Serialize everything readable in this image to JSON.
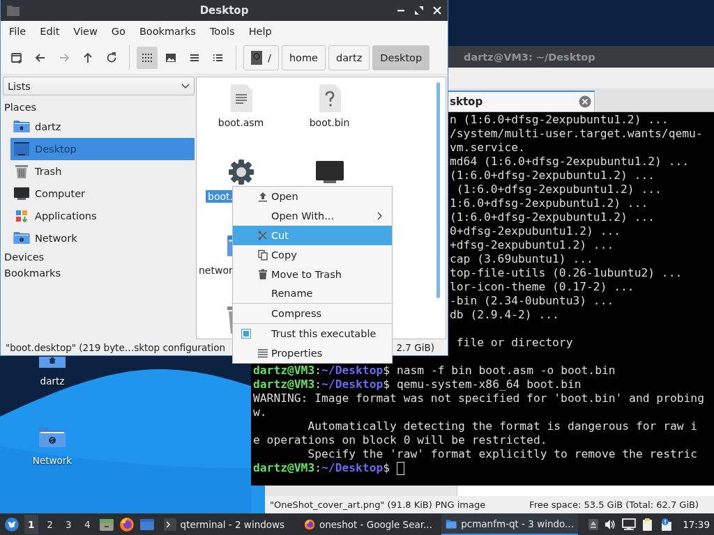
{
  "desktop_icons": [
    {
      "label": "dartz",
      "kind": "home"
    },
    {
      "label": "Network",
      "kind": "network"
    }
  ],
  "background_window": {
    "status_left": "\"OneShot_cover_art.png\" (91.8 KiB) PNG image",
    "status_right": "Free space: 53.5 GiB (Total: 62.7 GiB)"
  },
  "terminal": {
    "title": "dartz@VM3: ~/Desktop",
    "tab": "sktop",
    "lines": [
      {
        "kind": "partial",
        "text": "n (1:6.0+dfsg-2expubuntu1.2) ..."
      },
      {
        "kind": "partial",
        "text": "/system/multi-user.target.wants/qemu-"
      },
      {
        "kind": "partial",
        "text": "vm.service."
      },
      {
        "kind": "partial",
        "text": "md64 (1:6.0+dfsg-2expubuntu1.2) ..."
      },
      {
        "kind": "partial",
        "text": "(1:6.0+dfsg-2expubuntu1.2) ..."
      },
      {
        "kind": "partial",
        "text": " (1:6.0+dfsg-2expubuntu1.2) ..."
      },
      {
        "kind": "partial",
        "text": "1:6.0+dfsg-2expubuntu1.2) ..."
      },
      {
        "kind": "partial",
        "text": "(1:6.0+dfsg-2expubuntu1.2) ..."
      },
      {
        "kind": "partial",
        "text": "0+dfsg-2expubuntu1.2) ..."
      },
      {
        "kind": "partial",
        "text": "+dfsg-2expubuntu1.2) ..."
      },
      {
        "kind": "partial",
        "text": "cap (3.69ubuntu1) ..."
      },
      {
        "kind": "partial",
        "text": "top-file-utils (0.26-1ubuntu2) ..."
      },
      {
        "kind": "partial",
        "text": "lor-icon-theme (0.17-2) ..."
      },
      {
        "kind": "partial",
        "text": "-bin (2.34-0ubuntu3) ..."
      },
      {
        "kind": "partial",
        "text": "db (2.9.4-2) ..."
      },
      {
        "kind": "blank"
      },
      {
        "kind": "partial",
        "text": " file or directory"
      },
      {
        "kind": "blank"
      },
      {
        "kind": "prompt",
        "user": "dartz@VM3",
        "separator": ":",
        "path": "~/Desktop",
        "sign": "$",
        "command": "nasm -f bin boot.asm -o boot.bin"
      },
      {
        "kind": "prompt",
        "user": "dartz@VM3",
        "separator": ":",
        "path": "~/Desktop",
        "sign": "$",
        "command": "qemu-system-x86_64 boot.bin"
      },
      {
        "kind": "full",
        "text": "WARNING: Image format was not specified for 'boot.bin' and probing"
      },
      {
        "kind": "full",
        "text": "w."
      },
      {
        "kind": "full",
        "text": "        Automatically detecting the format is dangerous for raw i"
      },
      {
        "kind": "full",
        "text": "e operations on block 0 will be restricted."
      },
      {
        "kind": "full",
        "text": "        Specify the 'raw' format explicitly to remove the restric"
      },
      {
        "kind": "prompt",
        "user": "dartz@VM3",
        "separator": ":",
        "path": "~/Desktop",
        "sign": "$",
        "cursor": true
      }
    ]
  },
  "file_manager": {
    "title": "Desktop",
    "menu": [
      "File",
      "Edit",
      "View",
      "Go",
      "Bookmarks",
      "Tools",
      "Help"
    ],
    "toolbar": [
      {
        "kind": "new-window",
        "disabled": false
      },
      {
        "kind": "back",
        "disabled": false
      },
      {
        "kind": "forward",
        "disabled": true
      },
      {
        "kind": "up",
        "disabled": false
      },
      {
        "kind": "reload",
        "disabled": false
      }
    ],
    "view_modes": [
      {
        "kind": "icons",
        "selected": true
      },
      {
        "kind": "thumbnails",
        "selected": false
      },
      {
        "kind": "compact",
        "selected": false
      },
      {
        "kind": "details",
        "selected": false
      }
    ],
    "path": [
      {
        "kind": "root",
        "label": "/",
        "selected": false
      },
      {
        "kind": "dir",
        "label": "home",
        "selected": false
      },
      {
        "kind": "dir",
        "label": "dartz",
        "selected": false
      },
      {
        "kind": "dir",
        "label": "Desktop",
        "selected": true
      }
    ],
    "side_mode": "Lists",
    "places_title": "Places",
    "places": [
      {
        "label": "dartz",
        "kind": "home",
        "selected": false
      },
      {
        "label": "Desktop",
        "kind": "desktop",
        "selected": true
      },
      {
        "label": "Trash",
        "kind": "trash",
        "selected": false
      },
      {
        "label": "Computer",
        "kind": "computer",
        "selected": false
      },
      {
        "label": "Applications",
        "kind": "applications",
        "selected": false
      },
      {
        "label": "Network",
        "kind": "network",
        "selected": false
      }
    ],
    "other_sections": [
      "Devices",
      "Bookmarks"
    ],
    "files": [
      {
        "name": "boot.asm",
        "kind": "text",
        "selected": false
      },
      {
        "name": "boot.bin",
        "kind": "unknown",
        "selected": false
      },
      {
        "name": "boot.",
        "kind": "settings",
        "selected": true
      },
      {
        "kind": "computer",
        "selected": false
      },
      {
        "name": "networ",
        "kind": "folder",
        "selected": false
      },
      {
        "kind": "trash"
      }
    ],
    "status_left": "\"boot.desktop\" (219 byte…sktop configuration",
    "status_right": "2.7 GiB)"
  },
  "context_menu": [
    {
      "kind": "open",
      "label": "Open",
      "highlighted": false
    },
    {
      "kind": "none",
      "label": "Open With...",
      "submenu": true,
      "highlighted": false
    },
    {
      "kind": "cut",
      "label": "Cut",
      "highlighted": true
    },
    {
      "kind": "copy",
      "label": "Copy",
      "highlighted": false
    },
    {
      "kind": "trash",
      "label": "Move to Trash",
      "highlighted": false
    },
    {
      "kind": "none",
      "label": "Rename",
      "highlighted": false
    },
    {
      "kind": "separator"
    },
    {
      "kind": "none",
      "label": "Compress",
      "highlighted": false
    },
    {
      "kind": "separator"
    },
    {
      "kind": "checkbox",
      "label": "Trust this executable",
      "checked": true,
      "highlighted": false
    },
    {
      "kind": "properties",
      "label": "Properties",
      "highlighted": false
    }
  ],
  "taskbar": {
    "workspaces": [
      {
        "label": "1",
        "selected": true
      },
      {
        "label": "2",
        "selected": false
      },
      {
        "label": "3",
        "selected": false
      },
      {
        "label": "4",
        "selected": false
      }
    ],
    "launchers": [
      {
        "kind": "files"
      },
      {
        "kind": "firefox"
      },
      {
        "kind": "window"
      }
    ],
    "tasks": [
      {
        "kind": "terminal",
        "label": "qterminal - 2 windows",
        "selected": false
      },
      {
        "kind": "firefox",
        "label": "oneshot - Google Sear...",
        "selected": false
      },
      {
        "kind": "folder",
        "label": "pcmanfm-qt - 3 windo...",
        "selected": true
      }
    ],
    "tray": [
      {
        "kind": "eject"
      },
      {
        "kind": "volume"
      },
      {
        "kind": "network"
      },
      {
        "kind": "clipboard"
      },
      {
        "kind": "notification"
      }
    ],
    "clock": "17:39"
  }
}
